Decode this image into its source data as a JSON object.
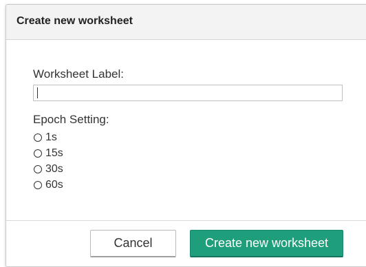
{
  "dialog": {
    "title": "Create new worksheet",
    "worksheet_label": {
      "label": "Worksheet Label:",
      "value": "",
      "placeholder": ""
    },
    "epoch_setting": {
      "label": "Epoch Setting:",
      "options": [
        "1s",
        "15s",
        "30s",
        "60s"
      ],
      "selected": null
    },
    "buttons": {
      "cancel_label": "Cancel",
      "create_label": "Create new worksheet"
    }
  },
  "colors": {
    "primary_button": "#1e9e7a",
    "header_background": "#f3f3f3"
  },
  "icons": {
    "radio": "radio-unchecked-icon"
  }
}
